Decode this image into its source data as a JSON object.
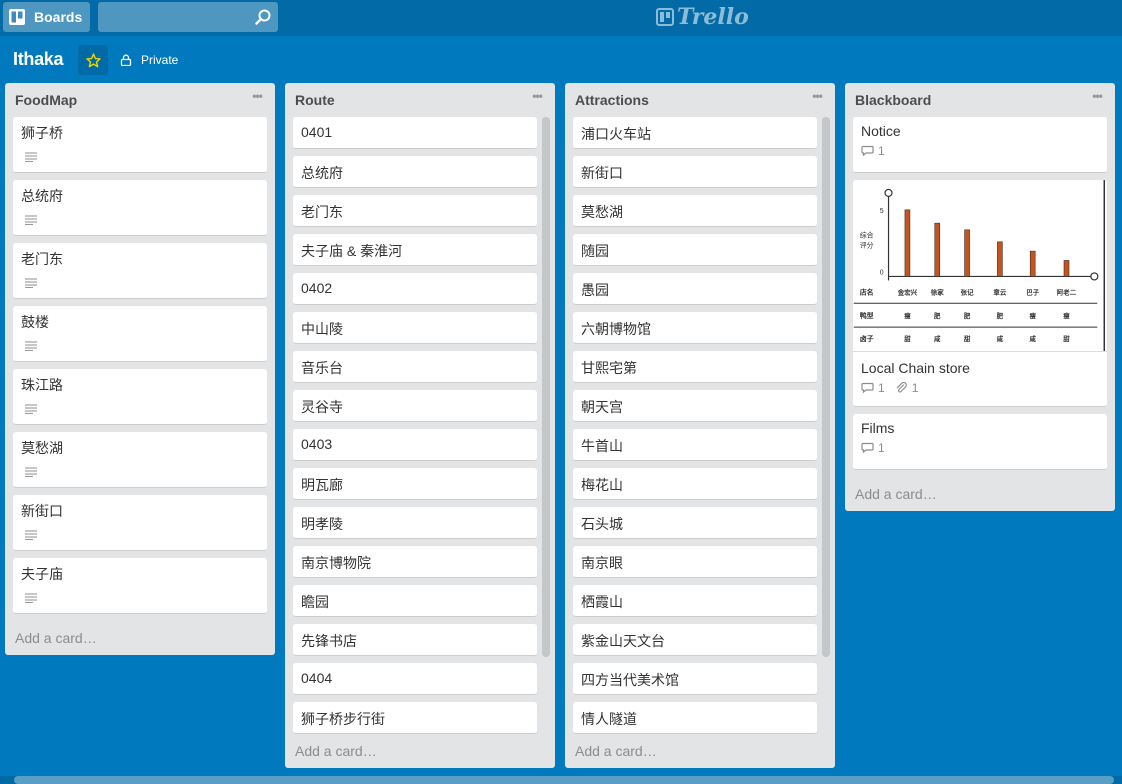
{
  "header": {
    "boards_label": "Boards",
    "search": {
      "value": "",
      "placeholder": ""
    },
    "logo_text": "Trello"
  },
  "board": {
    "title": "Ithaka",
    "privacy_label": "Private",
    "star_color": "#f2d600"
  },
  "lists": {
    "foodmap": {
      "title": "FoodMap",
      "cards": [
        "狮子桥",
        "总统府",
        "老门东",
        "鼓楼",
        "珠江路",
        "莫愁湖",
        "新街口",
        "夫子庙"
      ],
      "add_label": "Add a card…"
    },
    "route": {
      "title": "Route",
      "cards": [
        "0401",
        "总统府",
        "老门东",
        "夫子庙 & 秦淮河",
        "0402",
        "中山陵",
        "音乐台",
        "灵谷寺",
        "0403",
        "明瓦廊",
        "明孝陵",
        "南京博物院",
        "瞻园",
        "先锋书店",
        "0404",
        "狮子桥步行街"
      ],
      "add_label": "Add a card…"
    },
    "attractions": {
      "title": "Attractions",
      "cards": [
        "浦口火车站",
        "新街口",
        "莫愁湖",
        "随园",
        "愚园",
        "六朝博物馆",
        "甘熙宅第",
        "朝天宫",
        "牛首山",
        "梅花山",
        "石头城",
        "南京眼",
        "栖霞山",
        "紫金山天文台",
        "四方当代美术馆",
        "情人隧道"
      ],
      "add_label": "Add a card…"
    },
    "blackboard": {
      "title": "Blackboard",
      "cards": [
        {
          "title": "Notice",
          "comments": "1"
        },
        {
          "title": "Local Chain store",
          "comments": "1",
          "attachments": "1"
        },
        {
          "title": "Films",
          "comments": "1"
        }
      ],
      "add_label": "Add a card…"
    }
  },
  "cover_chart": {
    "y_axis_label": "综合评分",
    "y_ticks": [
      "5",
      "0"
    ],
    "row_labels": [
      "店名",
      "鸭型",
      "卤子"
    ],
    "stores": [
      "金宏兴",
      "徐家",
      "张记",
      "章云",
      "巴子",
      "阿老二"
    ],
    "scores": [
      5,
      4,
      3.5,
      2.6,
      1.9,
      1.2
    ],
    "duck_type": [
      "瘦",
      "肥",
      "肥",
      "肥",
      "瘦",
      "瘦"
    ],
    "sauce": [
      "甜",
      "咸",
      "甜",
      "咸",
      "咸",
      "甜"
    ],
    "bar_color": "#c8541c"
  }
}
